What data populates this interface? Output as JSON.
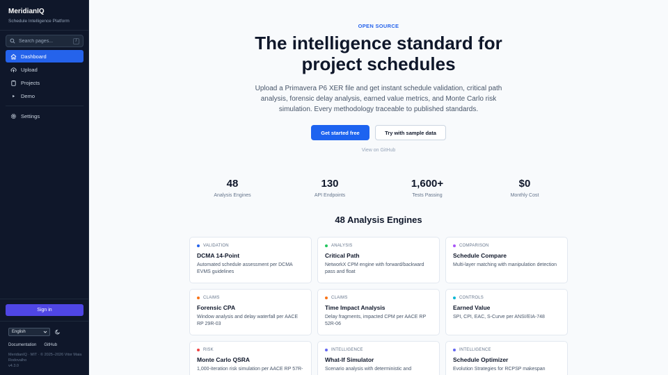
{
  "sidebar": {
    "brand": "MeridianIQ",
    "tagline": "Schedule Intelligence Platform",
    "search_placeholder": "Search pages...",
    "search_shortcut": "/",
    "items": [
      {
        "label": "Dashboard",
        "icon": "home-icon",
        "active": true
      },
      {
        "label": "Upload",
        "icon": "upload-cloud-icon",
        "active": false
      },
      {
        "label": "Projects",
        "icon": "clipboard-icon",
        "active": false
      },
      {
        "label": "Demo",
        "icon": "play-icon",
        "active": false
      }
    ],
    "settings_label": "Settings",
    "sign_in_label": "Sign in",
    "language": "English",
    "footer_links": [
      "Documentation",
      "GitHub"
    ],
    "copyright": "MeridianIQ · MIT · © 2025–2026 Vitor Maia Rodovalho",
    "version": "v4.3.0"
  },
  "hero": {
    "eyebrow": "OPEN SOURCE",
    "title": "The intelligence standard for project schedules",
    "description": "Upload a Primavera P6 XER file and get instant schedule validation, critical path analysis, forensic delay analysis, earned value metrics, and Monte Carlo risk simulation. Every methodology traceable to published standards.",
    "primary_cta": "Get started free",
    "secondary_cta": "Try with sample data",
    "github_link": "View on GitHub"
  },
  "stats": [
    {
      "value": "48",
      "label": "Analysis Engines"
    },
    {
      "value": "130",
      "label": "API Endpoints"
    },
    {
      "value": "1,600+",
      "label": "Tests Passing"
    },
    {
      "value": "$0",
      "label": "Monthly Cost"
    }
  ],
  "engines": {
    "title": "48 Analysis Engines",
    "cards": [
      {
        "tag": "VALIDATION",
        "color": "#2563eb",
        "title": "DCMA 14-Point",
        "desc": "Automated schedule assessment per DCMA EVMS guidelines"
      },
      {
        "tag": "ANALYSIS",
        "color": "#22c55e",
        "title": "Critical Path",
        "desc": "NetworkX CPM engine with forward/backward pass and float"
      },
      {
        "tag": "COMPARISON",
        "color": "#a855f7",
        "title": "Schedule Compare",
        "desc": "Multi-layer matching with manipulation detection"
      },
      {
        "tag": "CLAIMS",
        "color": "#f97316",
        "title": "Forensic CPA",
        "desc": "Window analysis and delay waterfall per AACE RP 29R-03"
      },
      {
        "tag": "CLAIMS",
        "color": "#f97316",
        "title": "Time Impact Analysis",
        "desc": "Delay fragments, impacted CPM per AACE RP 52R-06"
      },
      {
        "tag": "CONTROLS",
        "color": "#06b6d4",
        "title": "Earned Value",
        "desc": "SPI, CPI, EAC, S-Curve per ANSI/EIA-748"
      },
      {
        "tag": "RISK",
        "color": "#ef4444",
        "title": "Monte Carlo QSRA",
        "desc": "1,000-iteration risk simulation per AACE RP 57R-"
      },
      {
        "tag": "INTELLIGENCE",
        "color": "#6366f1",
        "title": "What-If Simulator",
        "desc": "Scenario analysis with deterministic and"
      },
      {
        "tag": "INTELLIGENCE",
        "color": "#6366f1",
        "title": "Schedule Optimizer",
        "desc": "Evolution Strategies for RCPSP makespan"
      }
    ]
  }
}
